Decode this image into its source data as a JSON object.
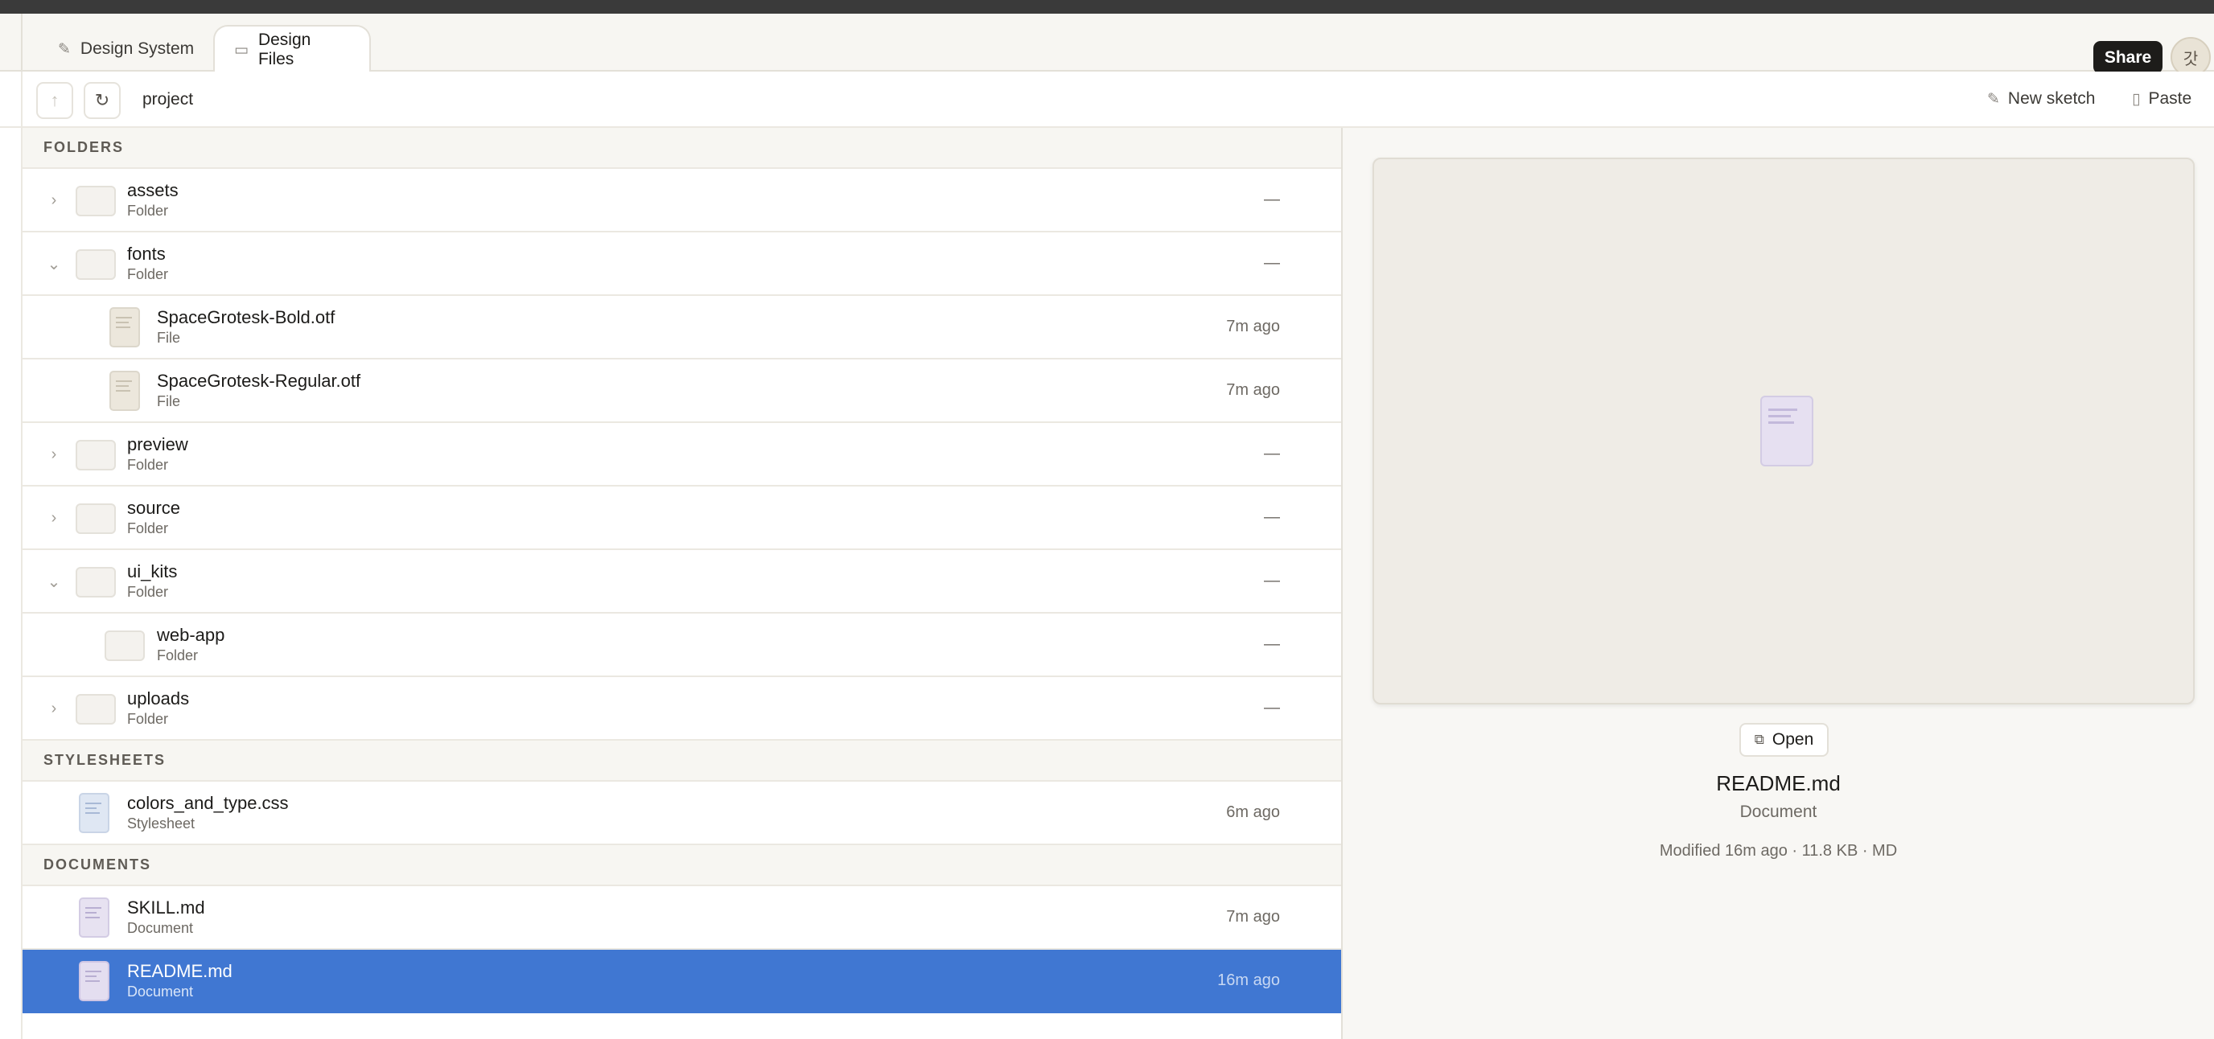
{
  "tabs": [
    {
      "label": "Design System",
      "icon": "pencil-icon"
    },
    {
      "label": "Design Files",
      "icon": "folder-icon",
      "active": true
    }
  ],
  "header": {
    "share_label": "Share",
    "avatar_initial": "갓"
  },
  "toolbar": {
    "breadcrumb": "project",
    "up_icon": "arrow-up-icon",
    "refresh_icon": "refresh-icon",
    "new_sketch_label": "New sketch",
    "paste_label": "Paste"
  },
  "sections": {
    "folders": "FOLDERS",
    "stylesheets": "STYLESHEETS",
    "documents": "DOCUMENTS"
  },
  "rows": {
    "assets": {
      "name": "assets",
      "kind": "Folder",
      "meta": "—",
      "expanded": false
    },
    "fonts": {
      "name": "fonts",
      "kind": "Folder",
      "meta": "—",
      "expanded": true
    },
    "bold": {
      "name": "SpaceGrotesk-Bold.otf",
      "kind": "File",
      "meta": "7m ago"
    },
    "regular": {
      "name": "SpaceGrotesk-Regular.otf",
      "kind": "File",
      "meta": "7m ago"
    },
    "preview": {
      "name": "preview",
      "kind": "Folder",
      "meta": "—",
      "expanded": false
    },
    "source": {
      "name": "source",
      "kind": "Folder",
      "meta": "—",
      "expanded": false
    },
    "ui_kits": {
      "name": "ui_kits",
      "kind": "Folder",
      "meta": "—",
      "expanded": true
    },
    "webapp": {
      "name": "web-app",
      "kind": "Folder",
      "meta": "—"
    },
    "uploads": {
      "name": "uploads",
      "kind": "Folder",
      "meta": "—",
      "expanded": false
    },
    "css": {
      "name": "colors_and_type.css",
      "kind": "Stylesheet",
      "meta": "6m ago"
    },
    "skill": {
      "name": "SKILL.md",
      "kind": "Document",
      "meta": "7m ago"
    },
    "readme": {
      "name": "README.md",
      "kind": "Document",
      "meta": "16m ago",
      "selected": true
    }
  },
  "preview": {
    "open_label": "Open",
    "name": "README.md",
    "type": "Document",
    "meta": "Modified 16m ago · 11.8 KB · MD"
  },
  "colors": {
    "selection": "#4077d2",
    "share_button": "#1d1c1a",
    "panel_background": "#f8f7f4"
  }
}
